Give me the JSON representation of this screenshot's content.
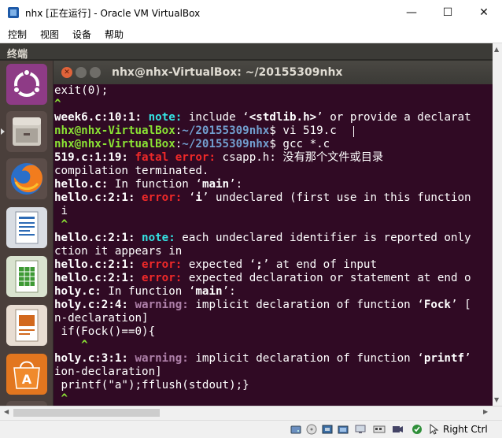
{
  "window": {
    "title": "nhx [正在运行] - Oracle VM VirtualBox",
    "minimize": "—",
    "maximize": "☐",
    "close": "✕"
  },
  "menu": [
    "控制",
    "视图",
    "设备",
    "帮助"
  ],
  "guest": {
    "topbar_label": "终端",
    "launcher": [
      {
        "name": "ubuntu-dash-icon"
      },
      {
        "name": "files-icon"
      },
      {
        "name": "firefox-icon"
      },
      {
        "name": "libreoffice-writer-icon"
      },
      {
        "name": "libreoffice-calc-icon"
      },
      {
        "name": "libreoffice-impress-icon"
      },
      {
        "name": "software-center-icon"
      },
      {
        "name": "help-icon"
      }
    ]
  },
  "terminal": {
    "title": "nhx@nhx-VirtualBox: ~/20155309nhx",
    "lines": [
      [
        {
          "t": "exit(0);",
          "c": ""
        }
      ],
      [
        {
          "t": "^",
          "c": "g"
        }
      ],
      [
        {
          "t": "week6.c:10:1: ",
          "c": "w"
        },
        {
          "t": "note:",
          "c": "cyan"
        },
        {
          "t": " include ‘",
          "c": ""
        },
        {
          "t": "<stdlib.h>",
          "c": "w"
        },
        {
          "t": "’ or provide a declarat",
          "c": ""
        }
      ],
      [
        {
          "t": "nhx@nhx-VirtualBox",
          "c": "g"
        },
        {
          "t": ":",
          "c": ""
        },
        {
          "t": "~/20155309nhx",
          "c": "b"
        },
        {
          "t": "$ vi 519.c",
          "c": ""
        }
      ],
      [
        {
          "t": "nhx@nhx-VirtualBox",
          "c": "g"
        },
        {
          "t": ":",
          "c": ""
        },
        {
          "t": "~/20155309nhx",
          "c": "b"
        },
        {
          "t": "$ gcc *.c",
          "c": ""
        }
      ],
      [
        {
          "t": "519.c:1:19: ",
          "c": "w"
        },
        {
          "t": "fatal error:",
          "c": "r"
        },
        {
          "t": " csapp.h: 没有那个文件或目录",
          "c": ""
        }
      ],
      [
        {
          "t": "compilation terminated.",
          "c": ""
        }
      ],
      [
        {
          "t": "hello.c:",
          "c": "w"
        },
        {
          "t": " In function ‘",
          "c": ""
        },
        {
          "t": "main",
          "c": "w"
        },
        {
          "t": "’:",
          "c": ""
        }
      ],
      [
        {
          "t": "hello.c:2:1: ",
          "c": "w"
        },
        {
          "t": "error:",
          "c": "r"
        },
        {
          "t": " ‘",
          "c": ""
        },
        {
          "t": "i",
          "c": "w"
        },
        {
          "t": "’ undeclared (first use in this function",
          "c": ""
        }
      ],
      [
        {
          "t": " i",
          "c": ""
        }
      ],
      [
        {
          "t": " ^",
          "c": "g"
        }
      ],
      [
        {
          "t": "hello.c:2:1: ",
          "c": "w"
        },
        {
          "t": "note:",
          "c": "cyan"
        },
        {
          "t": " each undeclared identifier is reported only",
          "c": ""
        }
      ],
      [
        {
          "t": "ction it appears in",
          "c": ""
        }
      ],
      [
        {
          "t": "hello.c:2:1: ",
          "c": "w"
        },
        {
          "t": "error:",
          "c": "r"
        },
        {
          "t": " expected ‘",
          "c": ""
        },
        {
          "t": ";",
          "c": "w"
        },
        {
          "t": "’ at end of input",
          "c": ""
        }
      ],
      [
        {
          "t": "hello.c:2:1: ",
          "c": "w"
        },
        {
          "t": "error:",
          "c": "r"
        },
        {
          "t": " expected declaration or statement at end o",
          "c": ""
        }
      ],
      [
        {
          "t": "holy.c:",
          "c": "w"
        },
        {
          "t": " In function ‘",
          "c": ""
        },
        {
          "t": "main",
          "c": "w"
        },
        {
          "t": "’:",
          "c": ""
        }
      ],
      [
        {
          "t": "holy.c:2:4: ",
          "c": "w"
        },
        {
          "t": "warning:",
          "c": "m"
        },
        {
          "t": " implicit declaration of function ‘",
          "c": ""
        },
        {
          "t": "Fock",
          "c": "w"
        },
        {
          "t": "’ [",
          "c": ""
        }
      ],
      [
        {
          "t": "n-declaration]",
          "c": ""
        }
      ],
      [
        {
          "t": " if(Fock()==0){",
          "c": ""
        }
      ],
      [
        {
          "t": "    ^",
          "c": "g"
        }
      ],
      [
        {
          "t": "holy.c:3:1: ",
          "c": "w"
        },
        {
          "t": "warning:",
          "c": "m"
        },
        {
          "t": " implicit declaration of function ‘",
          "c": ""
        },
        {
          "t": "printf",
          "c": "w"
        },
        {
          "t": "’",
          "c": ""
        }
      ],
      [
        {
          "t": "ion-declaration]",
          "c": ""
        }
      ],
      [
        {
          "t": " printf(\"a\");fflush(stdout);}",
          "c": ""
        }
      ],
      [
        {
          "t": " ^",
          "c": "g"
        }
      ]
    ]
  },
  "statusbar": {
    "host_key": "Right Ctrl",
    "icons": [
      "hard-disk-icon",
      "optical-drive-icon",
      "usb-icon",
      "shared-folders-icon",
      "display-icon",
      "network-icon",
      "recording-icon",
      "cpu-icon",
      "mouse-integration-icon"
    ]
  },
  "colors": {
    "terminal_bg": "#300a24",
    "prompt_green": "#8ae234",
    "path_blue": "#729fcf",
    "error_red": "#ef2929",
    "warning_magenta": "#ad7fa8",
    "note_cyan": "#34e2e2"
  }
}
